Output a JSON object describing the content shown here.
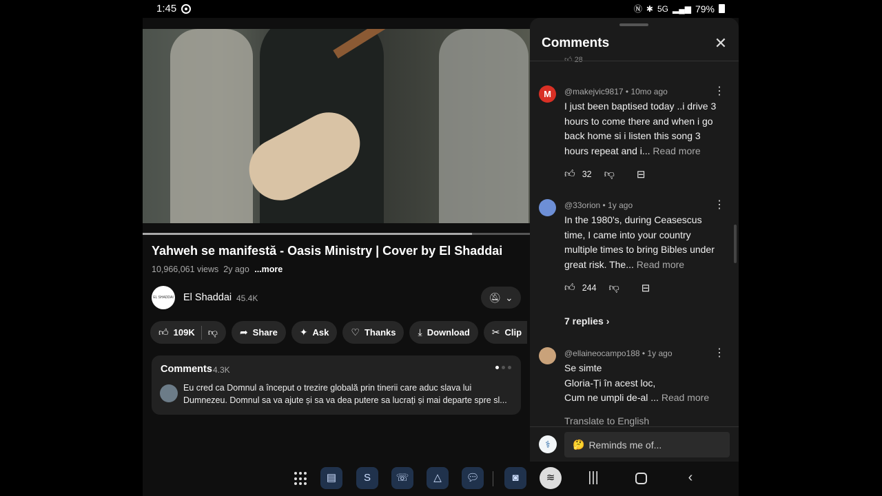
{
  "status_bar": {
    "time": "1:45",
    "network": "5G",
    "battery": "79%"
  },
  "video": {
    "progress": 0.85,
    "title": "Yahweh se manifestă - Oasis Ministry | Cover by El Shaddai",
    "views": "10,966,061 views",
    "age": "2y ago",
    "more": "...more"
  },
  "channel": {
    "name": "El Shaddai",
    "subscribers": "45.4K",
    "avatar_text": "EL SHADDAI"
  },
  "actions": {
    "likes": "109K",
    "share": "Share",
    "ask": "Ask",
    "thanks": "Thanks",
    "download": "Download",
    "clip": "Clip"
  },
  "comments_card": {
    "title": "Comments",
    "count": "4.3K",
    "preview": "Eu cred ca Domnul a început o trezire globală prin tinerii care aduc slava lui Dumnezeu. Domnul sa va ajute și sa va dea putere sa lucrați și mai departe spre sl..."
  },
  "panel": {
    "title": "Comments",
    "prev_likes": "28",
    "comments": [
      {
        "avatar_letter": "M",
        "avatar_color": "#d93025",
        "author": "@makejvic9817",
        "age": "10mo ago",
        "text": "I just been baptised today ..i drive 3 hours to come there and when i go back home si i listen this song 3 hours repeat and i...",
        "read_more": "Read more",
        "likes": "32"
      },
      {
        "avatar_letter": "",
        "avatar_color": "#6d8fd6",
        "author": "@33orion",
        "age": "1y ago",
        "text": "In the 1980's, during Ceasescus time, I came into your country multiple times to bring  Bibles under great risk. The...",
        "read_more": "Read more",
        "likes": "244",
        "replies": "7 replies"
      },
      {
        "avatar_letter": "",
        "avatar_color": "#c9a27a",
        "author": "@ellaineocampo188",
        "age": "1y ago",
        "text_lines": [
          "Se simte",
          "Gloria-Ți în acest loc,",
          "Cum ne umpli de-al ..."
        ],
        "read_more": "Read more",
        "translate": "Translate to English"
      }
    ],
    "input_placeholder": "Reminds me of...",
    "input_emoji": "🤔"
  },
  "colors": {
    "background": "#0f0f0f",
    "panel": "#1b1b1b",
    "chip": "#272727"
  }
}
